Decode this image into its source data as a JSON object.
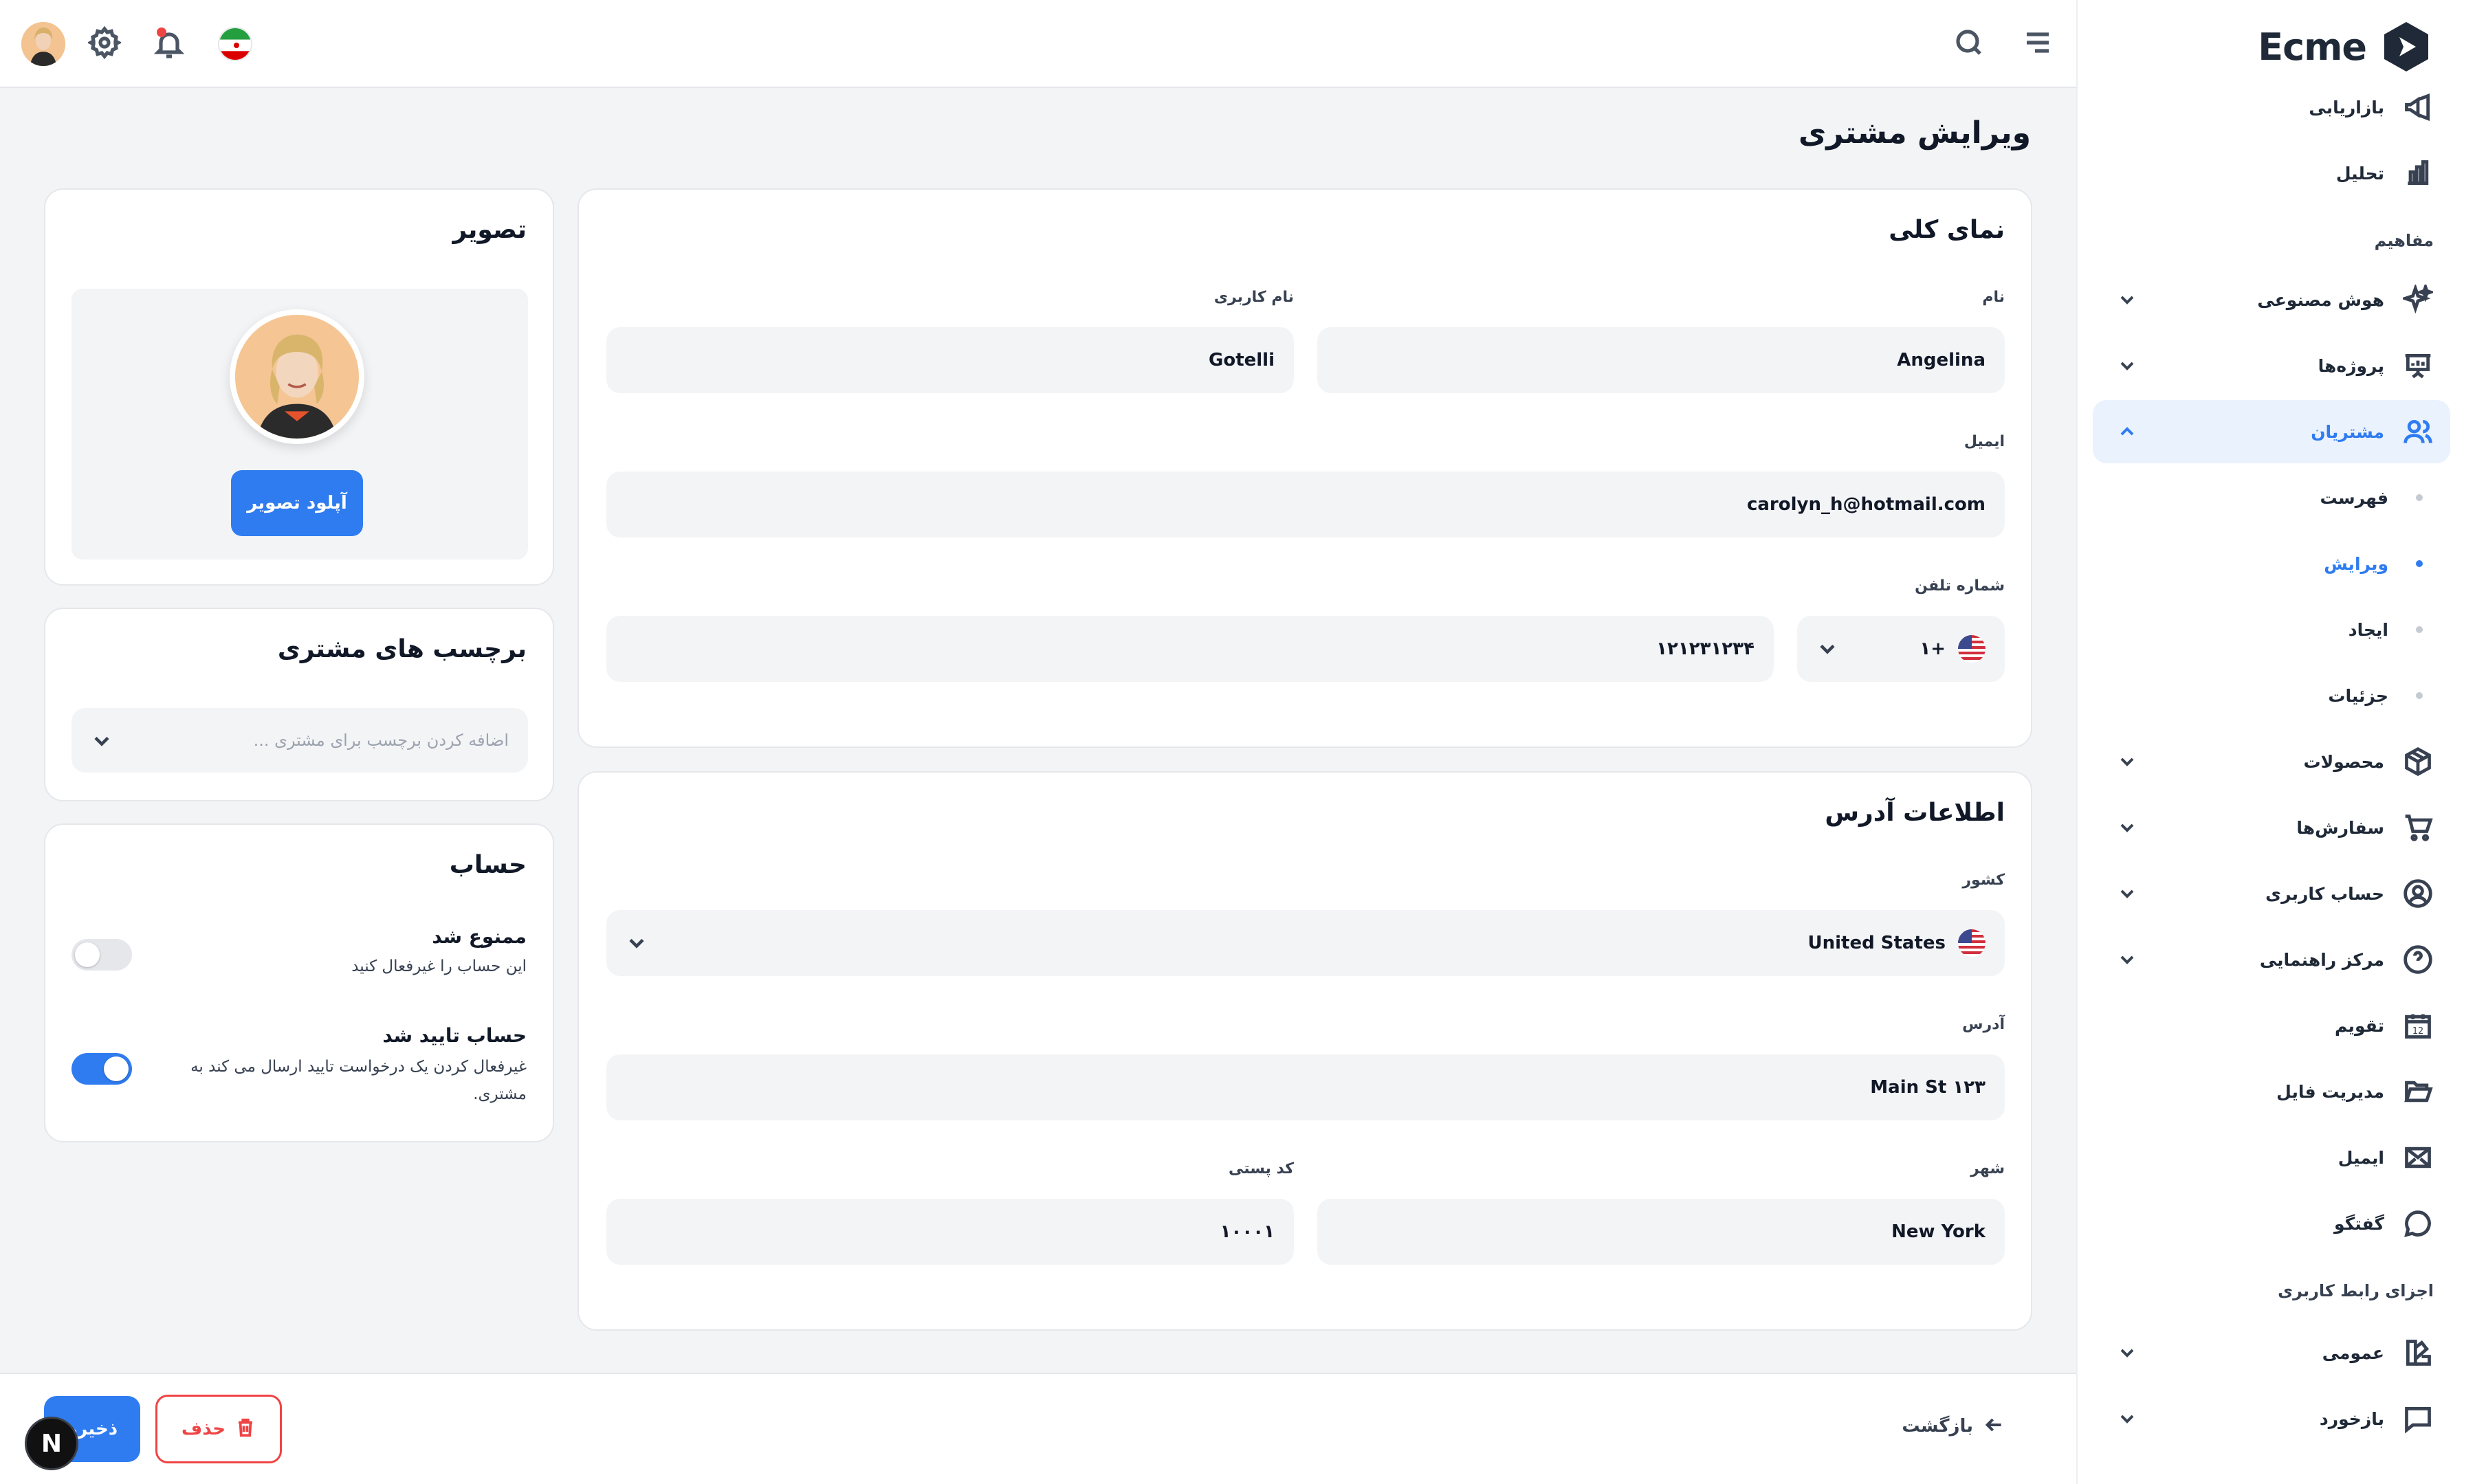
{
  "brand": {
    "name": "Ecme",
    "accent": "#2f7cf0"
  },
  "sidebar": {
    "items_top": [
      {
        "label": "بازاریابی",
        "icon": "megaphone-icon"
      },
      {
        "label": "تحلیل",
        "icon": "bar-chart-icon"
      }
    ],
    "group_concepts": "مفاهیم",
    "concept_items": [
      {
        "label": "هوش مصنوعی",
        "icon": "sparkles-icon"
      },
      {
        "label": "پروژه‌ها",
        "icon": "presentation-board-icon"
      },
      {
        "label": "مشتریان",
        "icon": "users-icon"
      }
    ],
    "customer_subitems": [
      {
        "label": "فهرست"
      },
      {
        "label": "ویرایش"
      },
      {
        "label": "ایجاد"
      },
      {
        "label": "جزئیات"
      }
    ],
    "more_items": [
      {
        "label": "محصولات",
        "icon": "box-icon"
      },
      {
        "label": "سفارش‌ها",
        "icon": "cart-icon"
      },
      {
        "label": "حساب کاربری",
        "icon": "user-circle-icon"
      },
      {
        "label": "مرکز راهنمایی",
        "icon": "help-circle-icon"
      },
      {
        "label": "تقویم",
        "icon": "calendar-icon",
        "day": "12"
      },
      {
        "label": "مدیریت فایل",
        "icon": "folder-open-icon"
      },
      {
        "label": "ایمیل",
        "icon": "mail-icon"
      },
      {
        "label": "گفتگو",
        "icon": "chat-bubble-icon"
      }
    ],
    "group_ui": "اجزای رابط کاربری",
    "ui_items": [
      {
        "label": "عمومی",
        "icon": "swatch-icon"
      },
      {
        "label": "بازخورد",
        "icon": "message-dots-icon"
      }
    ]
  },
  "header": {
    "icons": [
      "menu-icon",
      "search-icon",
      "iran-flag-icon",
      "bell-icon",
      "gear-icon",
      "user-avatar"
    ]
  },
  "page": {
    "title": "ویرایش مشتری",
    "overview": {
      "title": "نمای کلی",
      "first_name_label": "نام",
      "first_name_value": "Angelina",
      "username_label": "نام کاربری",
      "username_value": "Gotelli",
      "email_label": "ایمیل",
      "email_value": "carolyn_h@hotmail.com",
      "phone_label": "شماره تلفن",
      "phone_code": "+۱",
      "phone_number": "۱۲۱۲۳۱۲۳۴"
    },
    "address": {
      "title": "اطلاعات آدرس",
      "country_label": "کشور",
      "country_value": "United States",
      "address_label": "آدرس",
      "address_value": "Main St ۱۲۳",
      "city_label": "شهر",
      "city_value": "New York",
      "postal_label": "کد پستی",
      "postal_value": "۱۰۰۰۱"
    },
    "image": {
      "title": "تصویر",
      "upload_button": "آپلود تصویر"
    },
    "tags": {
      "title": "برچسب های مشتری",
      "placeholder": "اضافه کردن برچسب برای مشتری ..."
    },
    "account": {
      "title": "حساب",
      "banned_title": "ممنوع شد",
      "banned_desc": "این حساب را غیرفعال کنید",
      "banned_on": false,
      "verified_title": "حساب تایید شد",
      "verified_desc": "غیرفعال کردن یک درخواست تایید ارسال می کند به مشتری.",
      "verified_on": true
    }
  },
  "footer": {
    "back_label": "بازگشت",
    "delete_label": "حذف",
    "save_label": "ذخیره",
    "badge_letter": "N"
  }
}
